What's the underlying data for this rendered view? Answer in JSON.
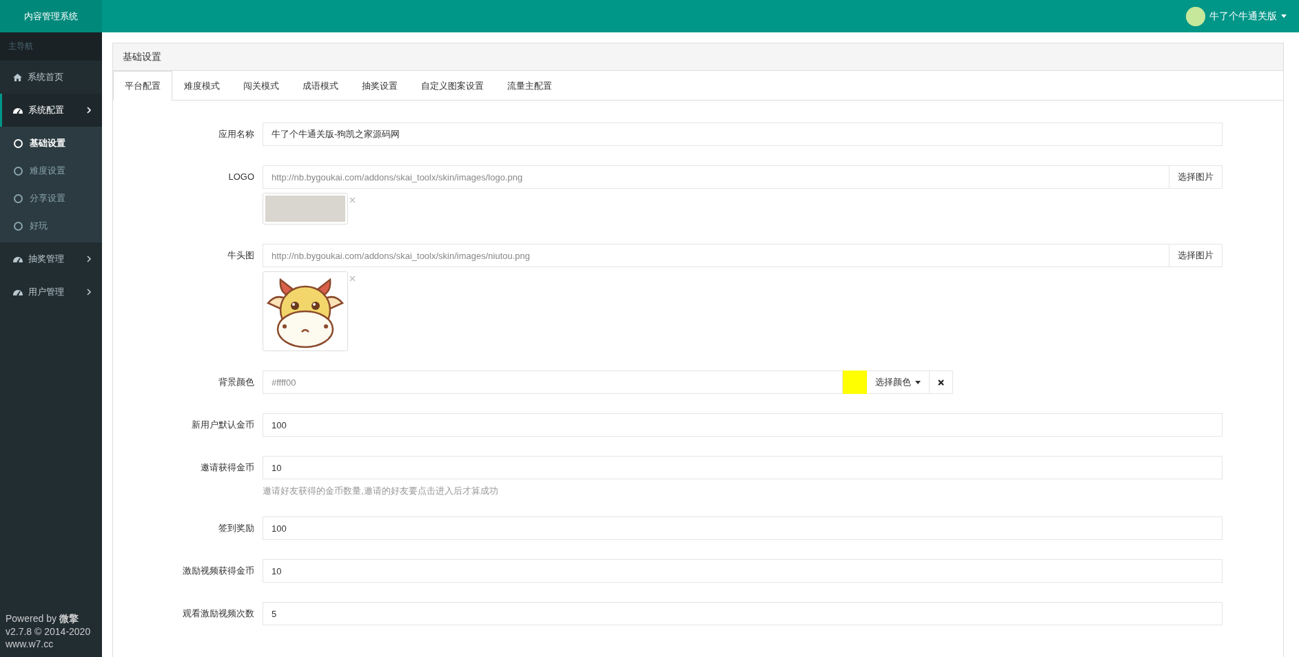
{
  "header": {
    "title": "内容管理系统",
    "user": "牛了个牛通关版"
  },
  "sidebar": {
    "section_label": "主导航",
    "items": [
      {
        "label": "系统首页",
        "kind": "link",
        "expanded": false
      },
      {
        "label": "系统配置",
        "kind": "menu",
        "expanded": true,
        "children": [
          {
            "label": "基础设置",
            "selected": true
          },
          {
            "label": "难度设置",
            "selected": false
          },
          {
            "label": "分享设置",
            "selected": false
          },
          {
            "label": "好玩",
            "selected": false
          }
        ]
      },
      {
        "label": "抽奖管理",
        "kind": "menu",
        "expanded": false
      },
      {
        "label": "用户管理",
        "kind": "menu",
        "expanded": false
      }
    ],
    "footer": "Powered by **微擎** v2.7.8 © 2014-2020 www.w7.cc"
  },
  "panel": {
    "title": "基础设置",
    "tabs": [
      {
        "label": "平台配置",
        "selected": true
      },
      {
        "label": "难度模式",
        "selected": false
      },
      {
        "label": "闯关模式",
        "selected": false
      },
      {
        "label": "成语模式",
        "selected": false
      },
      {
        "label": "抽奖设置",
        "selected": false
      },
      {
        "label": "自定义图案设置",
        "selected": false
      },
      {
        "label": "流量主配置",
        "selected": false
      }
    ],
    "rows": [
      {
        "kind": "text",
        "label": "应用名称",
        "value": "牛了个牛通关版-狗凯之家源码网"
      },
      {
        "kind": "image",
        "label": "LOGO",
        "placeholder": "http://nb.bygoukai.com/addons/skai_toolx/skin/images/logo.png",
        "button": "选择图片",
        "preview": {
          "kind": "banner"
        }
      },
      {
        "kind": "image",
        "label": "牛头图",
        "placeholder": "http://nb.bygoukai.com/addons/skai_toolx/skin/images/niutou.png",
        "button": "选择图片",
        "preview": {
          "kind": "cow"
        }
      },
      {
        "kind": "color",
        "label": "背景颜色",
        "placeholder": "#ffff00",
        "color": "#ffff00",
        "button": "选择颜色"
      },
      {
        "kind": "text",
        "label": "新用户默认金币",
        "value": "100"
      },
      {
        "kind": "text",
        "label": "邀请获得金币",
        "value": "10",
        "help": "邀请好友获得的金币数量,邀请的好友要点击进入后才算成功"
      },
      {
        "kind": "text",
        "label": "签到奖励",
        "value": "100"
      },
      {
        "kind": "text",
        "label": "激励视频获得金币",
        "value": "10"
      },
      {
        "kind": "text",
        "label": "观看激励视频次数",
        "value": "5"
      }
    ]
  }
}
